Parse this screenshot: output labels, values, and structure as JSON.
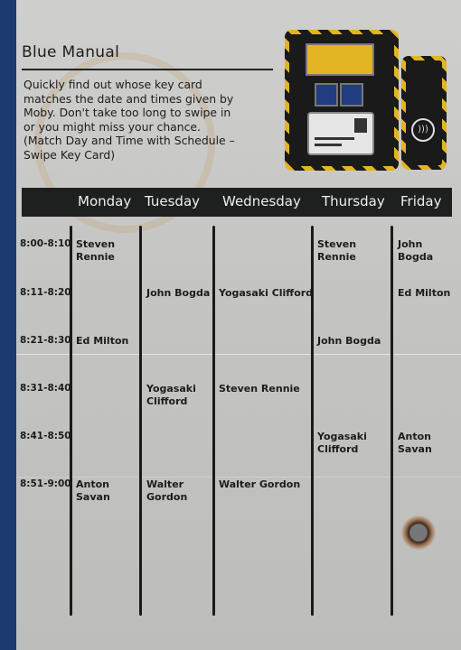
{
  "manual": {
    "title": "Blue Manual",
    "instructions": [
      "Quickly find out whose key card",
      "matches the date and times given by",
      "Moby. Don't take too long to swipe in",
      "or you might miss your chance.",
      "(Match Day and Time with Schedule –",
      "Swipe Key Card)"
    ]
  },
  "icons": {
    "machine": "key-card-machine-icon",
    "reader": "contactless-reader-icon",
    "burn": "burn-mark"
  },
  "colors": {
    "spine": "#1d3a6e",
    "header_bar": "#1e201f",
    "hazard": "#e2b521",
    "button": "#213d80"
  },
  "schedule": {
    "days": [
      "Monday",
      "Tuesday",
      "Wednesday",
      "Thursday",
      "Friday"
    ],
    "times": [
      "8:00-8:10",
      "8:11-8:20",
      "8:21-8:30",
      "8:31-8:40",
      "8:41-8:50",
      "8:51-9:00"
    ],
    "rows": [
      [
        "Steven Rennie",
        "",
        "",
        "Steven Rennie",
        "John Bogda"
      ],
      [
        "",
        "John Bogda",
        "Yogasaki Clifford",
        "",
        "Ed Milton"
      ],
      [
        "Ed Milton",
        "",
        "",
        "John Bogda",
        ""
      ],
      [
        "",
        "Yogasaki Clifford",
        "Steven Rennie",
        "",
        ""
      ],
      [
        "",
        "",
        "",
        "Yogasaki Clifford",
        "Anton Savan"
      ],
      [
        "Anton Savan",
        "Walter Gordon",
        "Walter Gordon",
        "",
        ""
      ]
    ]
  }
}
